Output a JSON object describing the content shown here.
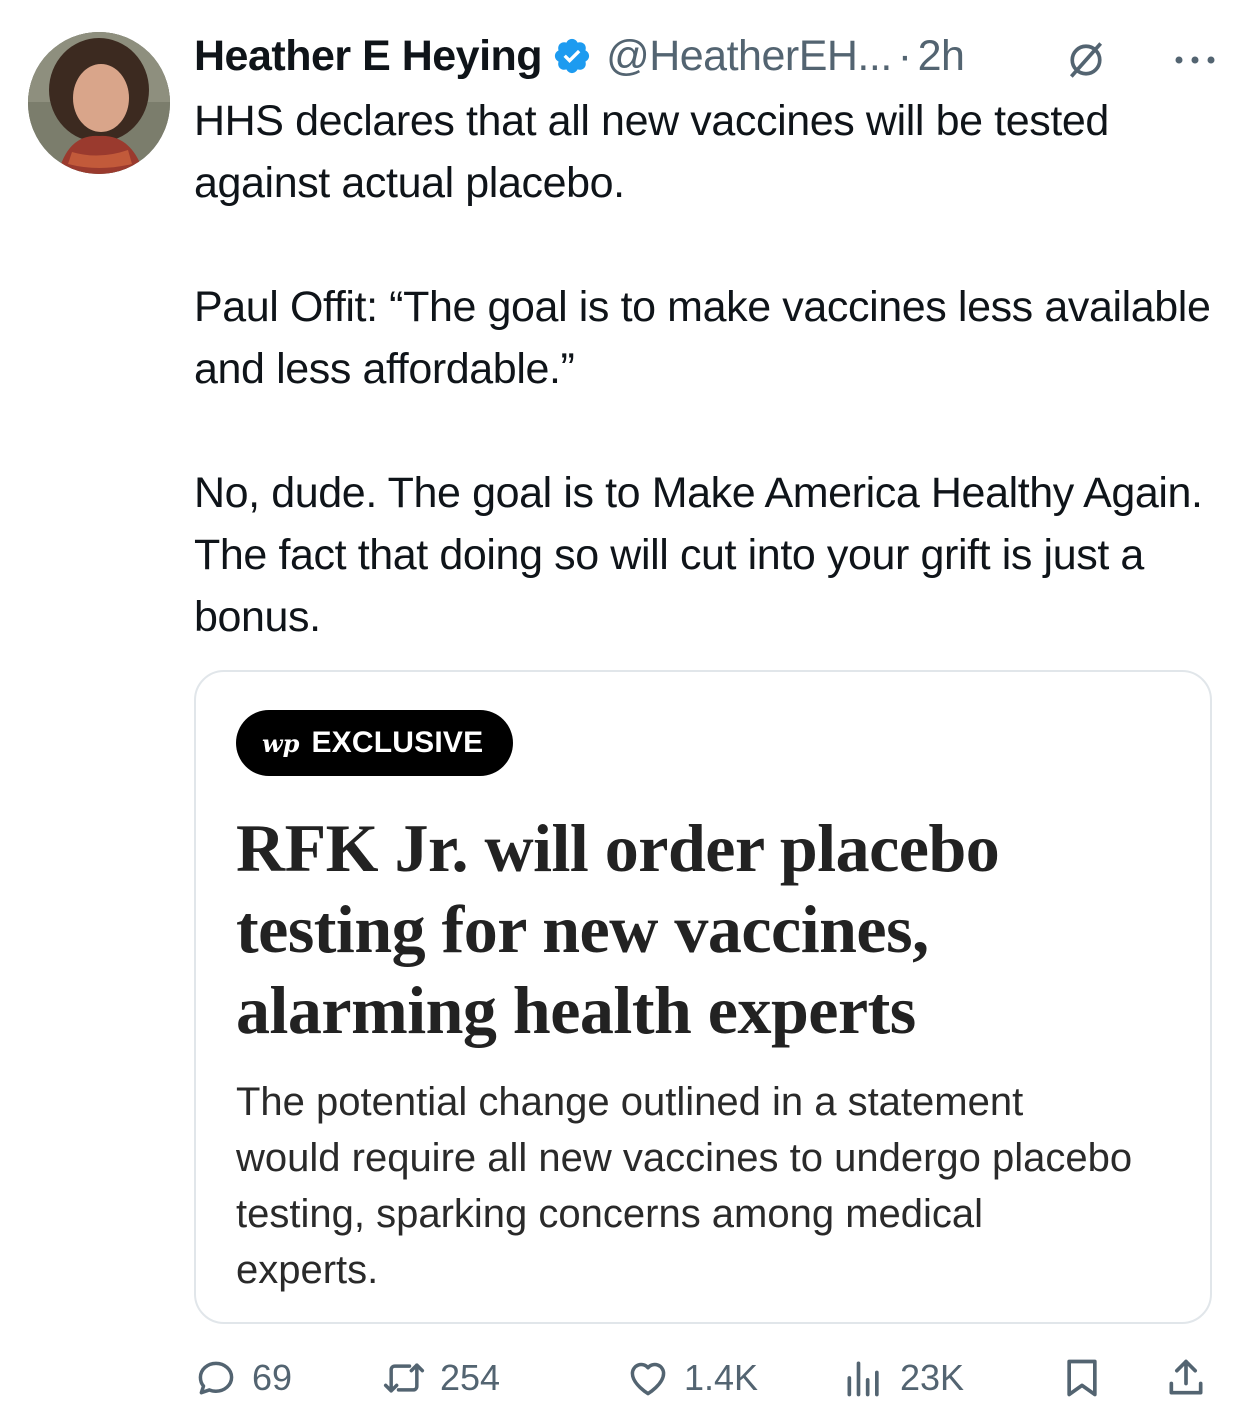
{
  "author": {
    "name": "Heather E Heying",
    "handle": "@HeatherEH...",
    "separator": "·",
    "time": "2h",
    "verified": true,
    "avatar_icon": "avatar-portrait"
  },
  "tweet": {
    "paragraphs": [
      "HHS declares that all new vaccines will be tested against actual placebo.",
      "Paul Offit: “The goal is to make vaccines less available and less affordable.”",
      "No, dude. The goal is to Make America Healthy Again. The fact that doing so will cut into your grift is just a bonus."
    ]
  },
  "card": {
    "badge_logo": "wp",
    "badge_label": "EXCLUSIVE",
    "headline": "RFK Jr. will order placebo testing for new vaccines, alarming health experts",
    "summary": "The potential change outlined in a statement would require all new vaccines to undergo placebo testing, sparking concerns among medical experts."
  },
  "actions": {
    "replies": "69",
    "reposts": "254",
    "likes": "1.4K",
    "views": "23K"
  },
  "colors": {
    "text": "#0f1419",
    "secondary": "#536471",
    "verified": "#1d9bf0",
    "card_border": "#e1e6ea"
  }
}
